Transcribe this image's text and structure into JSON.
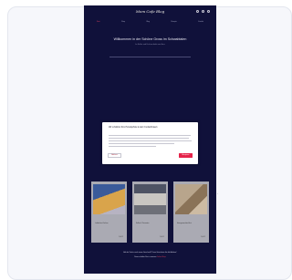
{
  "site": {
    "logo": "Mom Cafe Blog",
    "nav": [
      {
        "label": "Start",
        "active": true
      },
      {
        "label": "Shop",
        "active": false
      },
      {
        "label": "Blog",
        "active": false
      },
      {
        "label": "Rezepte",
        "active": false
      },
      {
        "label": "Kontakt",
        "active": false
      }
    ],
    "header_icons": [
      "search-icon",
      "user-icon",
      "cart-icon"
    ]
  },
  "hero": {
    "title": "Willkommen in der Schöne Gross im Schwabtalen",
    "subtitle": "Im Kaffee und Kuchen direkt vom Herz"
  },
  "cookie_modal": {
    "title": "Wir schätzen Ihre Privatsphäre & den Cookiehinweis",
    "decline": "Ablehnen",
    "accept": "Akzeptieren"
  },
  "products": [
    {
      "name": "Lebkuchen Kuchen",
      "price": "5,00 €",
      "colors": [
        "#3a5a9a",
        "#d9a44b"
      ]
    },
    {
      "name": "Kaffee & Teesorten",
      "price": "5,00 €",
      "colors": [
        "#4e5364",
        "#c9c6c2"
      ]
    },
    {
      "name": "Hausgemachtes Brot",
      "price": "5,00 €",
      "colors": [
        "#b8a58c",
        "#8a7358"
      ]
    }
  ],
  "footer": {
    "line1": "Auf der Suche nach einem Geschenk? Dann Gutscheine für alle Anlässe!",
    "line2_prefix": "Diese erhalten Sie in unserem",
    "line2_link": "Online-Shop"
  }
}
